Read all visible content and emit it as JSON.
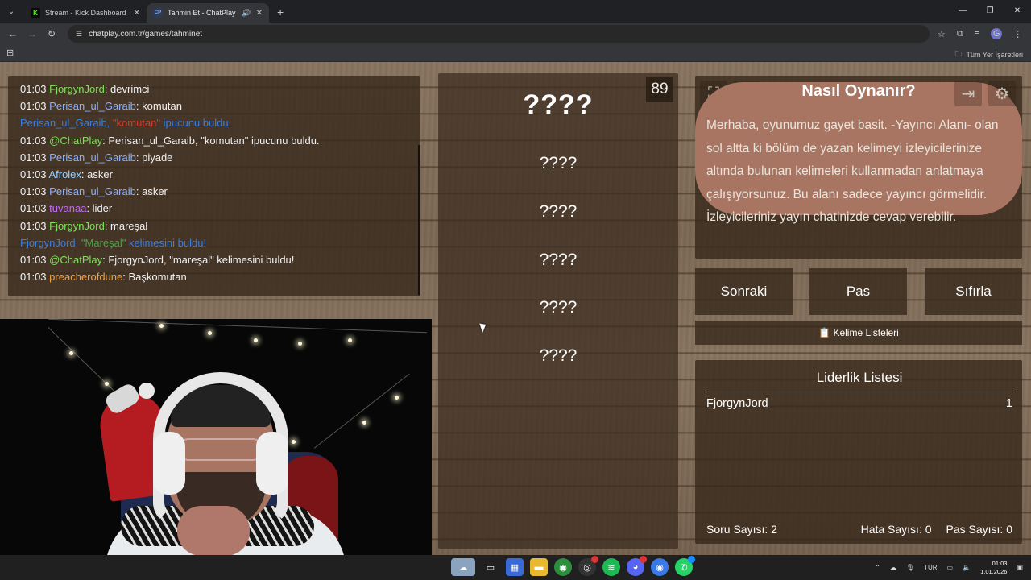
{
  "browser": {
    "tabs": [
      {
        "favicon": "K",
        "title": "Stream - Kick Dashboard",
        "active": false
      },
      {
        "favicon": "CP",
        "title": "Tahmin Et - ChatPlay",
        "active": true
      }
    ],
    "url": "chatplay.com.tr/games/tahminet",
    "bookmarks_all": "Tüm Yer İşaretleri"
  },
  "chat": {
    "messages": [
      {
        "type": "user",
        "time": "01:03",
        "user": "FjorgynJord",
        "color": "#7fe05a",
        "text": "devrimci"
      },
      {
        "type": "user",
        "time": "01:03",
        "user": "Perisan_ul_Garaib",
        "color": "#8ab0ff",
        "text": "komutan"
      },
      {
        "type": "sys_hint",
        "user": "Perisan_ul_Garaib, ",
        "word": "\"komutan\"",
        "rest": " ipucunu buldu."
      },
      {
        "type": "user",
        "time": "01:03",
        "user": "@ChatPlay",
        "color": "#7fe05a",
        "text": "Perisan_ul_Garaib, \"komutan\" ipucunu buldu."
      },
      {
        "type": "user",
        "time": "01:03",
        "user": "Perisan_ul_Garaib",
        "color": "#8ab0ff",
        "text": "piyade"
      },
      {
        "type": "user",
        "time": "01:03",
        "user": "Afrolex",
        "color": "#9ad0ff",
        "text": "asker"
      },
      {
        "type": "user",
        "time": "01:03",
        "user": "Perisan_ul_Garaib",
        "color": "#8ab0ff",
        "text": "asker"
      },
      {
        "type": "user",
        "time": "01:03",
        "user": "tuvanaa",
        "color": "#c36cf0",
        "text": "lider"
      },
      {
        "type": "user",
        "time": "01:03",
        "user": "FjorgynJord",
        "color": "#7fe05a",
        "text": "mareşal"
      },
      {
        "type": "sys_found",
        "user": "FjorgynJord, ",
        "word": "\"Mareşal\"",
        "rest": " kelimesini buldu!"
      },
      {
        "type": "user",
        "time": "01:03",
        "user": "@ChatPlay",
        "color": "#7fe05a",
        "text": "FjorgynJord, \"mareşal\" kelimesini buldu!"
      },
      {
        "type": "user",
        "time": "01:03",
        "user": "preacherofdune",
        "color": "#f0a040",
        "text": "Başkomutan"
      }
    ]
  },
  "game": {
    "timer": "89",
    "main_word": "????",
    "hidden_words": [
      "????",
      "????",
      "????",
      "????",
      "????"
    ]
  },
  "howto": {
    "title": "Nasıl Oynanır?",
    "description": "Merhaba, oyunumuz gayet basit. -Yayıncı Alanı- olan sol altta ki bölüm de yazan kelimeyi izleyicilerinize altında bulunan kelimeleri kullanmadan anlatmaya çalışıyorsunuz. Bu alanı sadece yayıncı görmelidir. İzleyicileriniz yayın chatinizde cevap verebilir."
  },
  "buttons": {
    "next": "Sonraki",
    "pass": "Pas",
    "reset": "Sıfırla"
  },
  "word_lists_label": "Kelime Listeleri",
  "leaderboard": {
    "title": "Liderlik Listesi",
    "rows": [
      {
        "name": "FjorgynJord",
        "score": "1"
      }
    ]
  },
  "stats": {
    "questions": "Soru Sayısı: 2",
    "errors": "Hata Sayısı: 0",
    "passes": "Pas Sayısı: 0"
  },
  "taskbar": {
    "language": "TUR",
    "time": "01:03",
    "date": "1.01.2026"
  }
}
